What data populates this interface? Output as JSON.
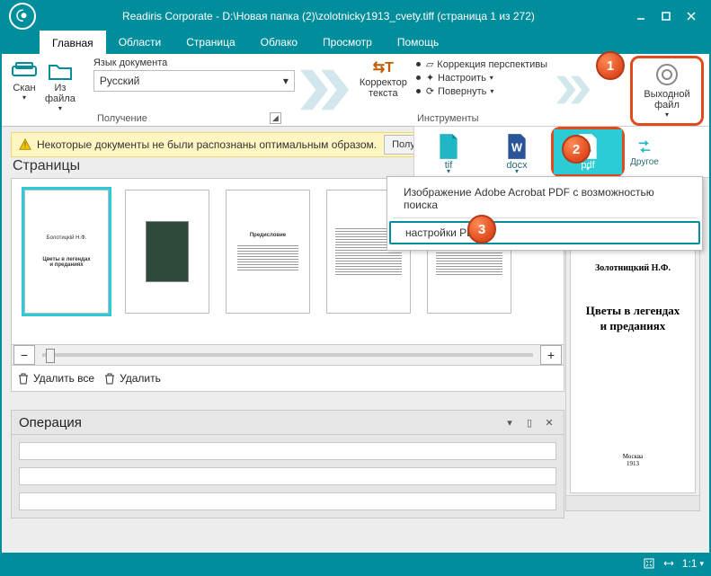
{
  "titlebar": {
    "title": "Readiris Corporate - D:\\Новая папка (2)\\zolotnicky1913_cvety.tiff (страница 1 из 272)"
  },
  "tabs": {
    "home": "Главная",
    "zones": "Области",
    "page": "Страница",
    "cloud": "Облако",
    "view": "Просмотр",
    "help": "Помощь"
  },
  "ribbon": {
    "scan": "Скан",
    "fromfile": "Из\nфайла",
    "lang_label": "Язык документа",
    "lang_value": "Русский",
    "group_get": "Получение",
    "text_corrector": "Корректор\nтекста",
    "perspective": "Коррекция перспективы",
    "adjust": "Настроить",
    "rotate": "Повернуть",
    "group_tools": "Инструменты",
    "output": "Выходной\nфайл"
  },
  "export": {
    "tif": "tif",
    "docx": "docx",
    "pdf": "pdf",
    "other": "Другое"
  },
  "pdfmenu": {
    "item1": "Изображение Adobe Acrobat PDF с возможностью поиска",
    "item2": "настройки PDF"
  },
  "warn": {
    "text": "Некоторые документы не были распознаны оптимальным образом.",
    "btn": "Получи"
  },
  "pages": {
    "title": "Страницы",
    "thumb1_author": "Болотицкій Н.Ф.",
    "thumb1_title": "Цветы в легендах\nи преданиях",
    "thumb3_title": "Предисловие",
    "delete_all": "Удалить все",
    "delete": "Удалить"
  },
  "ops": {
    "title": "Операция"
  },
  "preview": {
    "author": "Золотницкий Н.Ф.",
    "title": "Цветы в легендах\nи преданиях",
    "footer1": "Москва",
    "footer2": "1913"
  },
  "status": {
    "zoom": "1:1"
  },
  "badges": {
    "b1": "1",
    "b2": "2",
    "b3": "3"
  }
}
